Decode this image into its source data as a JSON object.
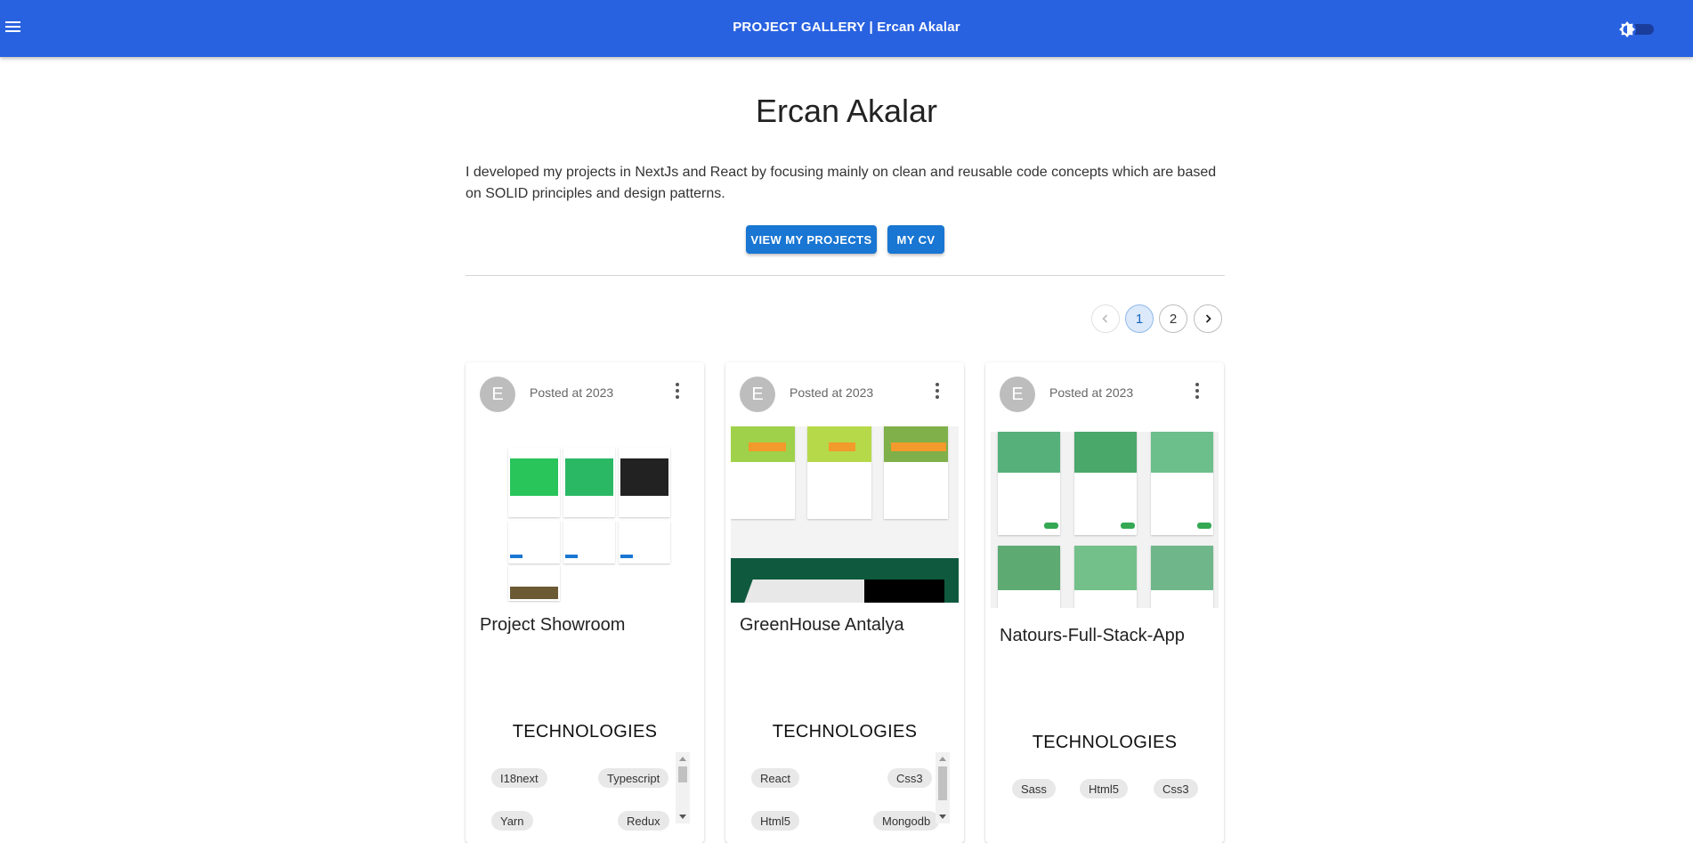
{
  "appbar": {
    "title": "PROJECT GALLERY  | Ercan Akalar",
    "menu_icon": "hamburger-menu-icon",
    "theme_icon": "brightness-icon"
  },
  "hero": {
    "name": "Ercan Akalar",
    "description": "I developed my projects in NextJs and React by focusing mainly on clean and reusable code concepts which are based on SOLID principles and design patterns.",
    "view_projects_label": "VIEW MY PROJECTS",
    "cv_label": "MY CV"
  },
  "pagination": {
    "pages": [
      "1",
      "2"
    ],
    "current": "1"
  },
  "cards": [
    {
      "avatar": "E",
      "posted": "Posted at 2023",
      "title": "Project Showroom",
      "tech_heading": "TECHNOLOGIES",
      "technologies": [
        "I18next",
        "Typescript",
        "Yarn",
        "Redux"
      ]
    },
    {
      "avatar": "E",
      "posted": "Posted at 2023",
      "title": "GreenHouse Antalya",
      "tech_heading": "TECHNOLOGIES",
      "technologies": [
        "React",
        "Css3",
        "Html5",
        "Mongodb"
      ]
    },
    {
      "avatar": "E",
      "posted": "Posted at 2023",
      "title": "Natours-Full-Stack-App",
      "tech_heading": "TECHNOLOGIES",
      "technologies": [
        "Sass",
        "Html5",
        "Css3"
      ]
    }
  ],
  "colors": {
    "appbar": "#2962e0",
    "button": "#1976d2",
    "avatar": "#bdbdbd",
    "chip": "#e8e8e8"
  }
}
